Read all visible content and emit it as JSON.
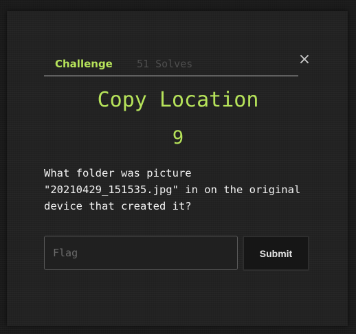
{
  "modal": {
    "tabs": {
      "challenge_label": "Challenge",
      "solves_label": "51 Solves"
    },
    "close_glyph": "×",
    "challenge": {
      "name": "Copy Location",
      "points": "9",
      "description": "What folder was picture\n\"20210429_151535.jpg\" in on the original\ndevice that created it?"
    },
    "form": {
      "flag_placeholder": "Flag",
      "flag_value": "",
      "submit_label": "Submit"
    }
  },
  "colors": {
    "accent": "#b6e35a",
    "background": "#1b1b1b",
    "modal": "#222222"
  }
}
